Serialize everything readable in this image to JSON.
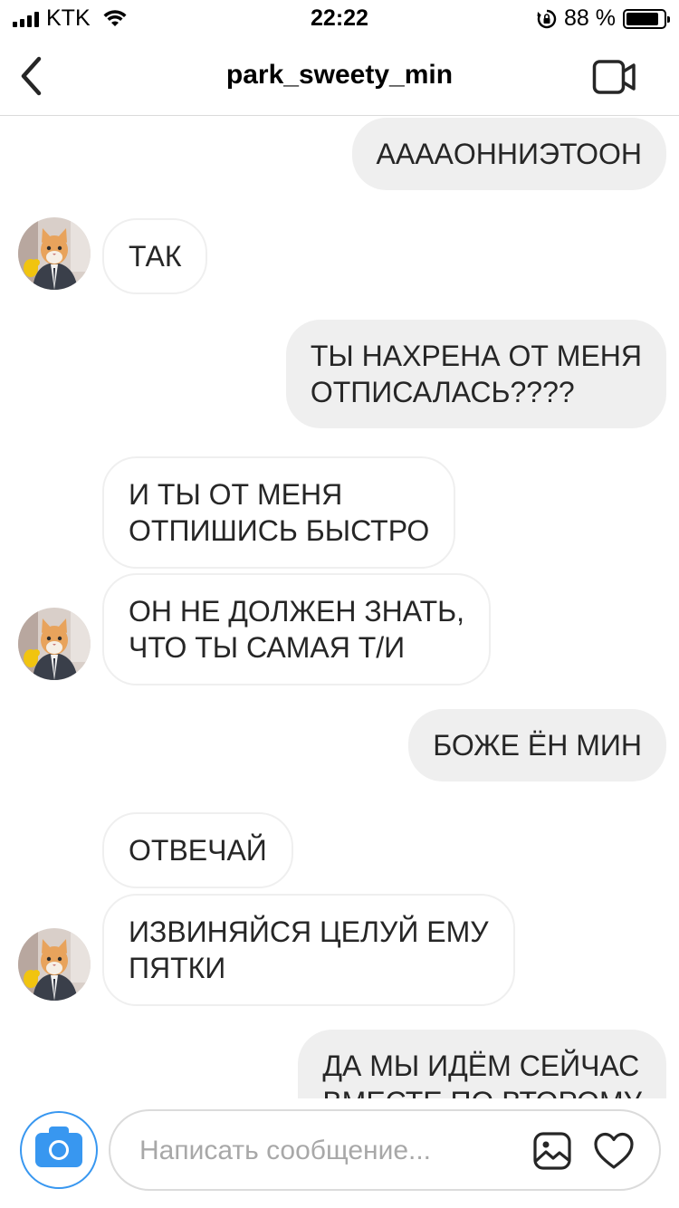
{
  "status_bar": {
    "carrier": "KTK",
    "time": "22:22",
    "battery_percent_label": "88 %",
    "battery_level": 0.88
  },
  "header": {
    "title": "park_sweety_min",
    "back_icon": "chevron-left-icon",
    "video_icon": "video-camera-icon"
  },
  "messages": [
    {
      "side": "out",
      "text": "АААAОННИЭТООН"
    },
    {
      "side": "in",
      "text": "ТАК"
    },
    {
      "side": "out",
      "text": "ТЫ НАХРЕНА ОТ МЕНЯ\nОТПИСАЛАСЬ????"
    },
    {
      "side": "in",
      "text": "И ТЫ ОТ МЕНЯ\nОТПИШИСЬ БЫСТРО"
    },
    {
      "side": "in",
      "text": "ОН НЕ ДОЛЖЕН ЗНАТЬ,\nЧТО ТЫ САМАЯ Т/И"
    },
    {
      "side": "out",
      "text": "БОЖЕ ЁН МИН"
    },
    {
      "side": "in",
      "text": "ОТВЕЧАЙ"
    },
    {
      "side": "in",
      "text": "ИЗВИНЯЙСЯ ЦЕЛУЙ ЕМУ\nПЯТКИ"
    },
    {
      "side": "out",
      "text": "ДА МЫ ИДЁМ СЕЙЧАС\nВМЕСТЕ ПО ВТОРОМУ"
    }
  ],
  "composer": {
    "placeholder": "Написать сообщение...",
    "value": "",
    "camera_icon": "camera-icon",
    "gallery_icon": "gallery-icon",
    "like_icon": "heart-icon"
  },
  "colors": {
    "accent": "#3897f0",
    "outgoing_bubble": "#efefef",
    "incoming_border": "#efefef"
  }
}
